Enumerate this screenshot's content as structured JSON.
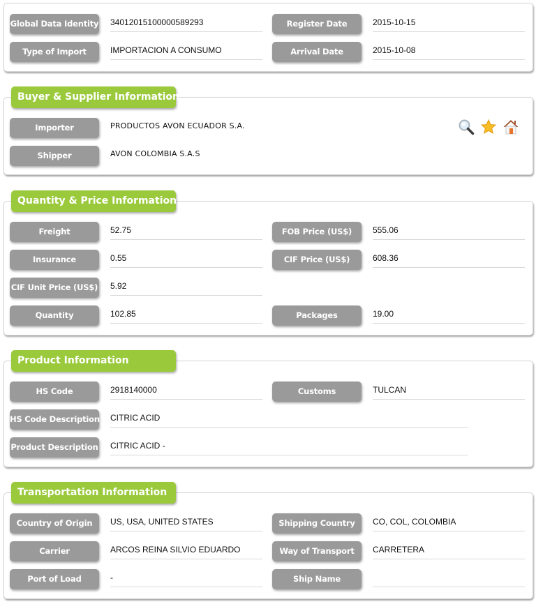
{
  "summary": {
    "global_data_identity": {
      "label": "Global Data Identity",
      "value": "34012015100000589293"
    },
    "register_date": {
      "label": "Register Date",
      "value": "2015-10-15"
    },
    "type_of_import": {
      "label": "Type of Import",
      "value": "IMPORTACION A CONSUMO"
    },
    "arrival_date": {
      "label": "Arrival Date",
      "value": "2015-10-08"
    }
  },
  "buyer_supplier": {
    "title": "Buyer & Supplier Information",
    "importer": {
      "label": "Importer",
      "value": "PRODUCTOS AVON ECUADOR S.A."
    },
    "shipper": {
      "label": "Shipper",
      "value": "AVON COLOMBIA S.A.S"
    },
    "icons": [
      "search-icon",
      "star-icon",
      "home-icon"
    ]
  },
  "quantity_price": {
    "title": "Quantity & Price Information",
    "freight": {
      "label": "Freight",
      "value": "52.75"
    },
    "fob_price": {
      "label": "FOB Price (US$)",
      "value": "555.06"
    },
    "insurance": {
      "label": "Insurance",
      "value": "0.55"
    },
    "cif_price": {
      "label": "CIF Price (US$)",
      "value": "608.36"
    },
    "cif_unit_price": {
      "label": "CIF Unit Price (US$)",
      "value": "5.92"
    },
    "quantity": {
      "label": "Quantity",
      "value": "102.85"
    },
    "packages": {
      "label": "Packages",
      "value": "19.00"
    }
  },
  "product": {
    "title": "Product Information",
    "hs_code": {
      "label": "HS Code",
      "value": "2918140000"
    },
    "customs": {
      "label": "Customs",
      "value": "TULCAN"
    },
    "hs_code_description": {
      "label": "HS Code Description",
      "value": "CITRIC ACID"
    },
    "product_description": {
      "label": "Product Description",
      "value": "CITRIC ACID -"
    }
  },
  "transportation": {
    "title": "Transportation Information",
    "country_of_origin": {
      "label": "Country of Origin",
      "value": "US, USA, UNITED STATES"
    },
    "shipping_country": {
      "label": "Shipping Country",
      "value": "CO, COL, COLOMBIA"
    },
    "carrier": {
      "label": "Carrier",
      "value": "ARCOS REINA SILVIO EDUARDO"
    },
    "way_of_transport": {
      "label": "Way of Transport",
      "value": "CARRETERA"
    },
    "port_of_load": {
      "label": "Port of Load",
      "value": "-"
    },
    "ship_name": {
      "label": "Ship Name",
      "value": ""
    }
  },
  "colors": {
    "section_tab": "#9aca3c",
    "label_button": "#9a9a9a"
  }
}
